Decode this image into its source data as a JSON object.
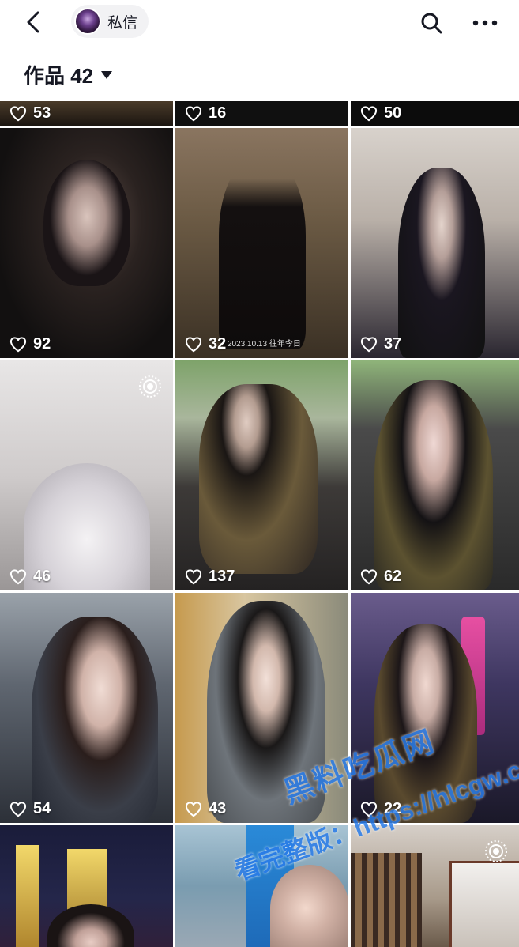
{
  "header": {
    "dm_label": "私信",
    "icons": [
      "back-arrow-icon",
      "avatar",
      "search-icon",
      "more-icon"
    ]
  },
  "tabs": {
    "works_label": "作品 42"
  },
  "top_row_likes": [
    "53",
    "16",
    "50"
  ],
  "posts": [
    {
      "likes": "92"
    },
    {
      "likes": "32",
      "caption": "2023.10.13 往年今日"
    },
    {
      "likes": "37"
    },
    {
      "likes": "46"
    },
    {
      "likes": "137"
    },
    {
      "likes": "62"
    },
    {
      "likes": "54"
    },
    {
      "likes": "43"
    },
    {
      "likes": "22"
    }
  ],
  "watermark": {
    "line1": "黑料吃瓜网",
    "line2": "看完整版：https://hlcgw.co"
  },
  "colors": {
    "text": "#161823",
    "watermark": "#2b7de9"
  }
}
